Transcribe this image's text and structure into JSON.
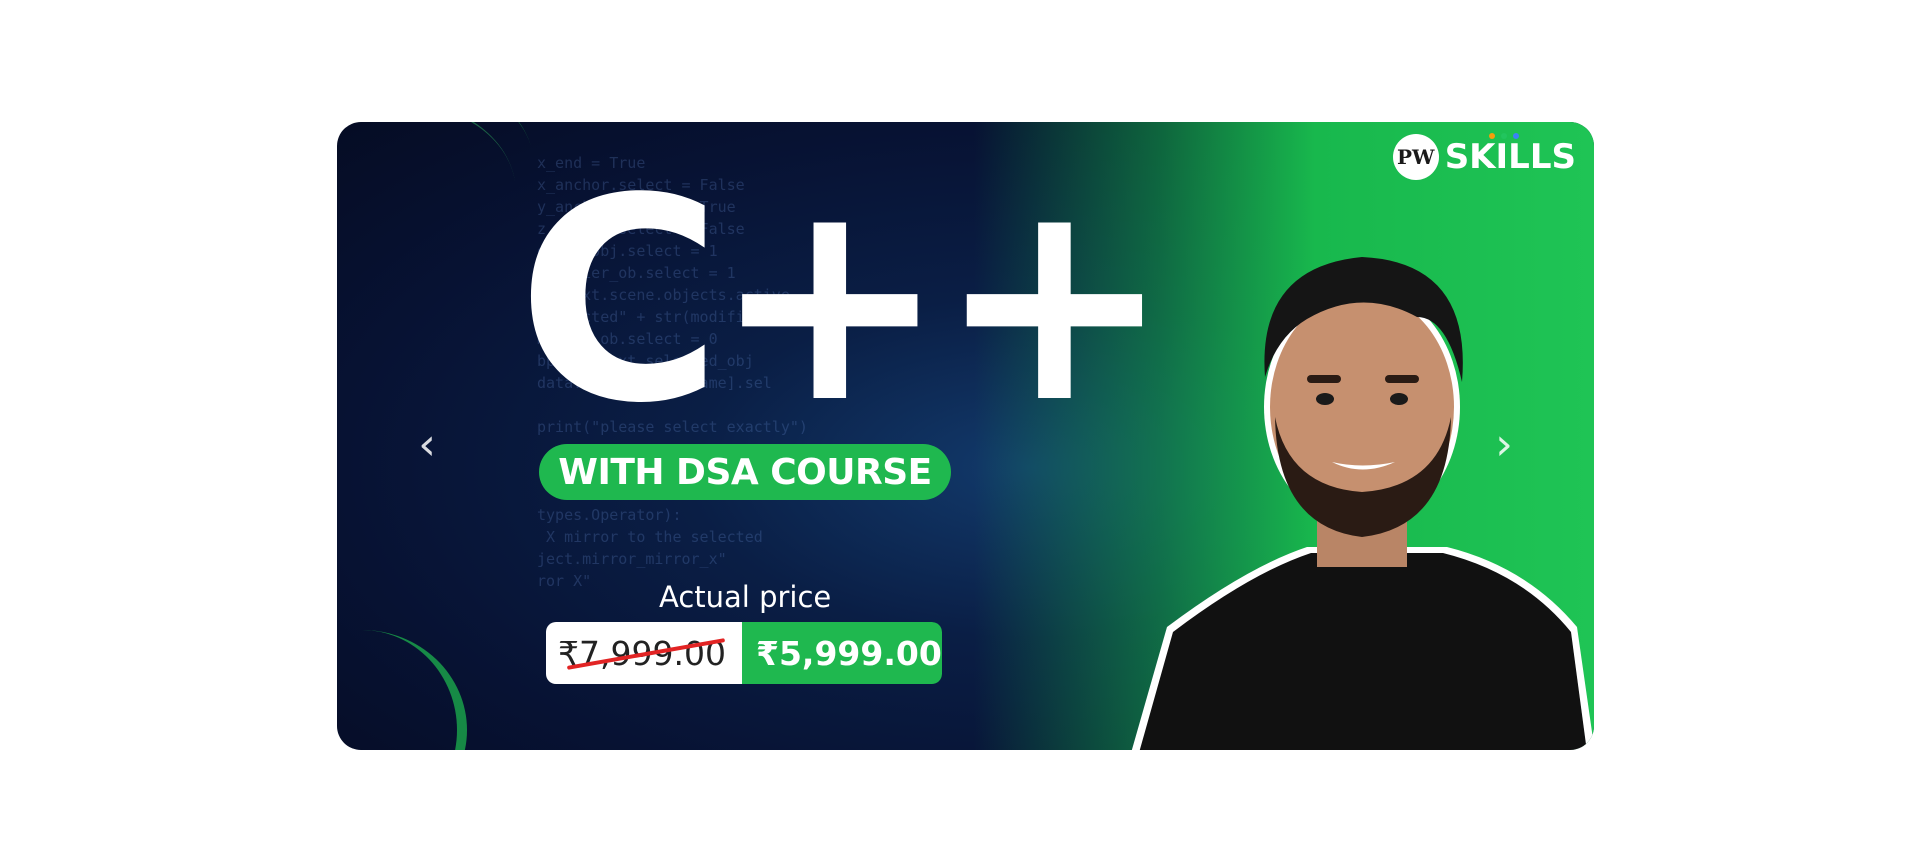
{
  "banner": {
    "title": "C++",
    "subtitle": "WITH DSA COURSE",
    "actual_price_label": "Actual price",
    "old_price": "₹7,999.00",
    "new_price": "₹5,999.00",
    "brand_name": "SKILLS",
    "brand_mark": "PW",
    "colors": {
      "accent_green": "#1fb84f",
      "background_navy": "#071233",
      "strike_red": "#e22424"
    },
    "code_background": "x_end = True\nx_anchor.select = False\ny_anchor.select = True\nz_anchor.select = False\nerror_obj.select = 1\nmodifier_ob.select = 1\ncontext.scene.objects.active\n\"Selected\" + str(modifier\nmirror_ob.select = 0\nbpy.context.selected_obj\ndata.objects[one.name].sel\n\nprint(\"please select exactly\")\n\n- OPERATOR CLASSES -\n\ntypes.Operator):\n X mirror to the selected\nject.mirror_mirror_x\"\nror X\""
  },
  "carousel": {
    "prev_icon": "chevron-left-icon",
    "next_icon": "chevron-right-icon"
  }
}
